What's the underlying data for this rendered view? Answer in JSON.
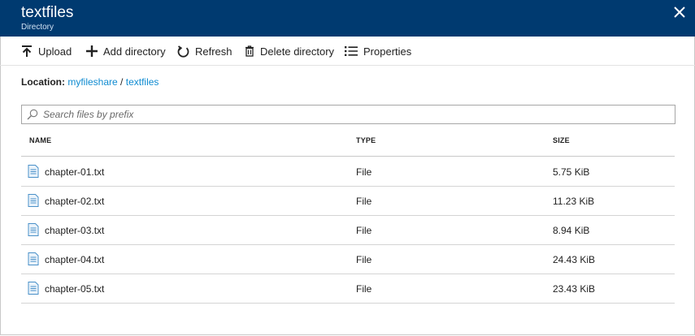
{
  "header": {
    "title": "textfiles",
    "subtitle": "Directory"
  },
  "toolbar": {
    "upload": "Upload",
    "add_directory": "Add directory",
    "refresh": "Refresh",
    "delete_directory": "Delete directory",
    "properties": "Properties"
  },
  "location": {
    "label": "Location:",
    "share": "myfileshare",
    "separator": "/",
    "directory": "textfiles"
  },
  "search": {
    "placeholder": "Search files by prefix"
  },
  "table": {
    "headers": {
      "name": "NAME",
      "type": "TYPE",
      "size": "SIZE"
    },
    "rows": [
      {
        "name": "chapter-01.txt",
        "type": "File",
        "size": "5.75 KiB"
      },
      {
        "name": "chapter-02.txt",
        "type": "File",
        "size": "11.23 KiB"
      },
      {
        "name": "chapter-03.txt",
        "type": "File",
        "size": "8.94 KiB"
      },
      {
        "name": "chapter-04.txt",
        "type": "File",
        "size": "24.43 KiB"
      },
      {
        "name": "chapter-05.txt",
        "type": "File",
        "size": "23.43 KiB"
      }
    ]
  },
  "colors": {
    "header_bg": "#003a70",
    "link": "#0f8bd1",
    "file_icon": "#4a90c8"
  },
  "icons": [
    "close-icon",
    "upload-icon",
    "add-icon",
    "refresh-icon",
    "trash-icon",
    "properties-icon",
    "search-icon",
    "file-icon"
  ]
}
